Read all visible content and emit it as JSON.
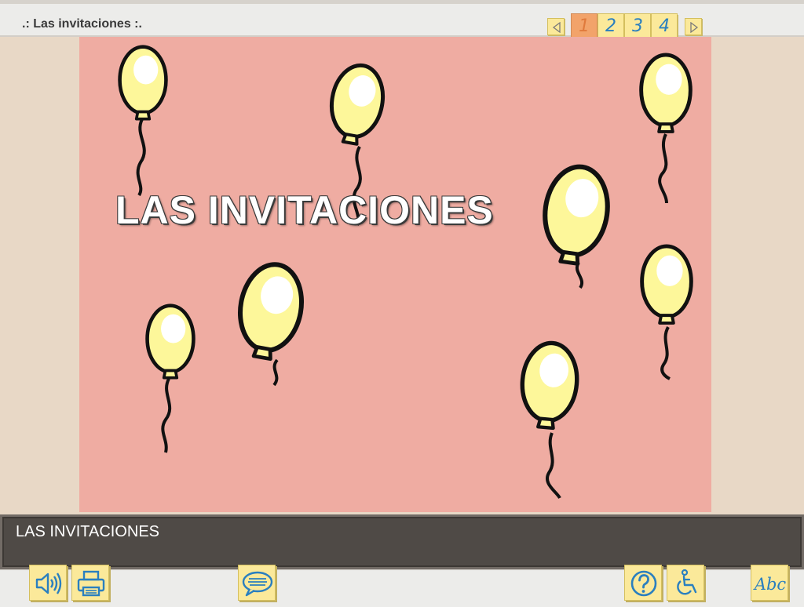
{
  "header": {
    "title": ".: Las invitaciones :.",
    "pages": [
      "1",
      "2",
      "3",
      "4"
    ],
    "current_page": "1"
  },
  "stage": {
    "title": "LAS INVITACIONES",
    "background_color": "#efaca2",
    "balloon_color": "#fdf79a"
  },
  "caption": {
    "text": "LAS INVITACIONES"
  },
  "toolbar": {
    "icons": [
      "speaker-icon",
      "printer-icon",
      "speech-bubble-icon",
      "help-icon",
      "accessibility-icon",
      "abc-icon"
    ],
    "abc_label": "Abc"
  },
  "colors": {
    "accent": "#2a7fbf",
    "button_yellow": "#fbe99a",
    "active_page": "#f2a36a"
  }
}
